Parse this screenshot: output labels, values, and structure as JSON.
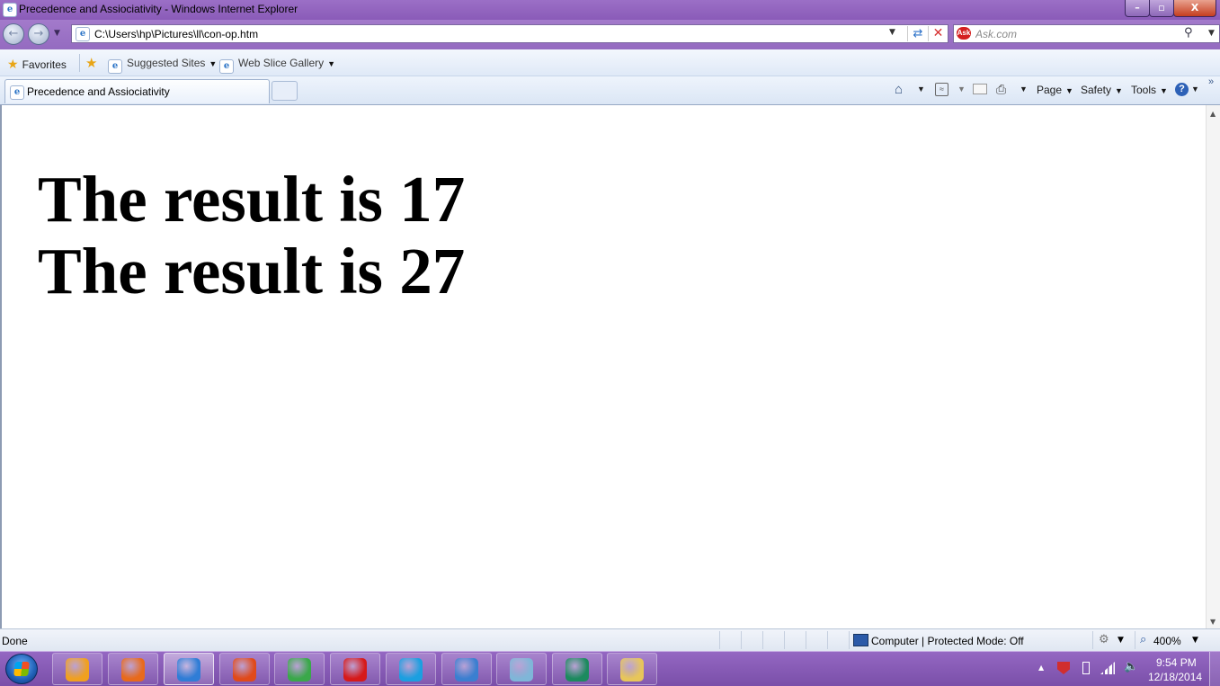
{
  "window": {
    "title": "Precedence and Assiociativity - Windows Internet Explorer",
    "minimize_glyph": "–",
    "maximize_glyph": "▫",
    "close_glyph": "X"
  },
  "navigation": {
    "address": "C:\\Users\\hp\\Pictures\\ll\\con-op.htm",
    "search_placeholder": "Ask.com",
    "search_logo": "Ask"
  },
  "favorites_bar": {
    "favorites_label": "Favorites",
    "items": [
      {
        "label": "Suggested Sites",
        "icon": "ie-page-icon"
      },
      {
        "label": "Web Slice Gallery",
        "icon": "ie-page-icon"
      }
    ]
  },
  "tabs": [
    {
      "label": "Precedence and Assiociativity",
      "active": true
    }
  ],
  "command_bar": {
    "page_label": "Page",
    "safety_label": "Safety",
    "tools_label": "Tools"
  },
  "content": {
    "lines": [
      "The result is 17",
      "The result is 27"
    ]
  },
  "status_bar": {
    "status": "Done",
    "zone": "Computer | Protected Mode: Off",
    "zoom": "400%"
  },
  "taskbar": {
    "apps": [
      {
        "icon": "media-player-icon",
        "color": "#f0a020"
      },
      {
        "icon": "firefox-icon",
        "color": "#e86a1b"
      },
      {
        "icon": "internet-explorer-icon",
        "color": "#2f7dd6",
        "active": true
      },
      {
        "icon": "firefox-beta-icon",
        "color": "#e04a1a"
      },
      {
        "icon": "chrome-icon",
        "color": "#3aa84a"
      },
      {
        "icon": "opera-icon",
        "color": "#d61a1a"
      },
      {
        "icon": "skype-icon",
        "color": "#1b9fe0"
      },
      {
        "icon": "paint-icon",
        "color": "#3b7fd0"
      },
      {
        "icon": "eraser-app-icon",
        "color": "#7fb6d8"
      },
      {
        "icon": "publisher-icon",
        "color": "#1c8a5e"
      },
      {
        "icon": "file-explorer-icon",
        "color": "#e7c65a"
      }
    ],
    "clock_time": "9:54 PM",
    "clock_date": "12/18/2014"
  }
}
